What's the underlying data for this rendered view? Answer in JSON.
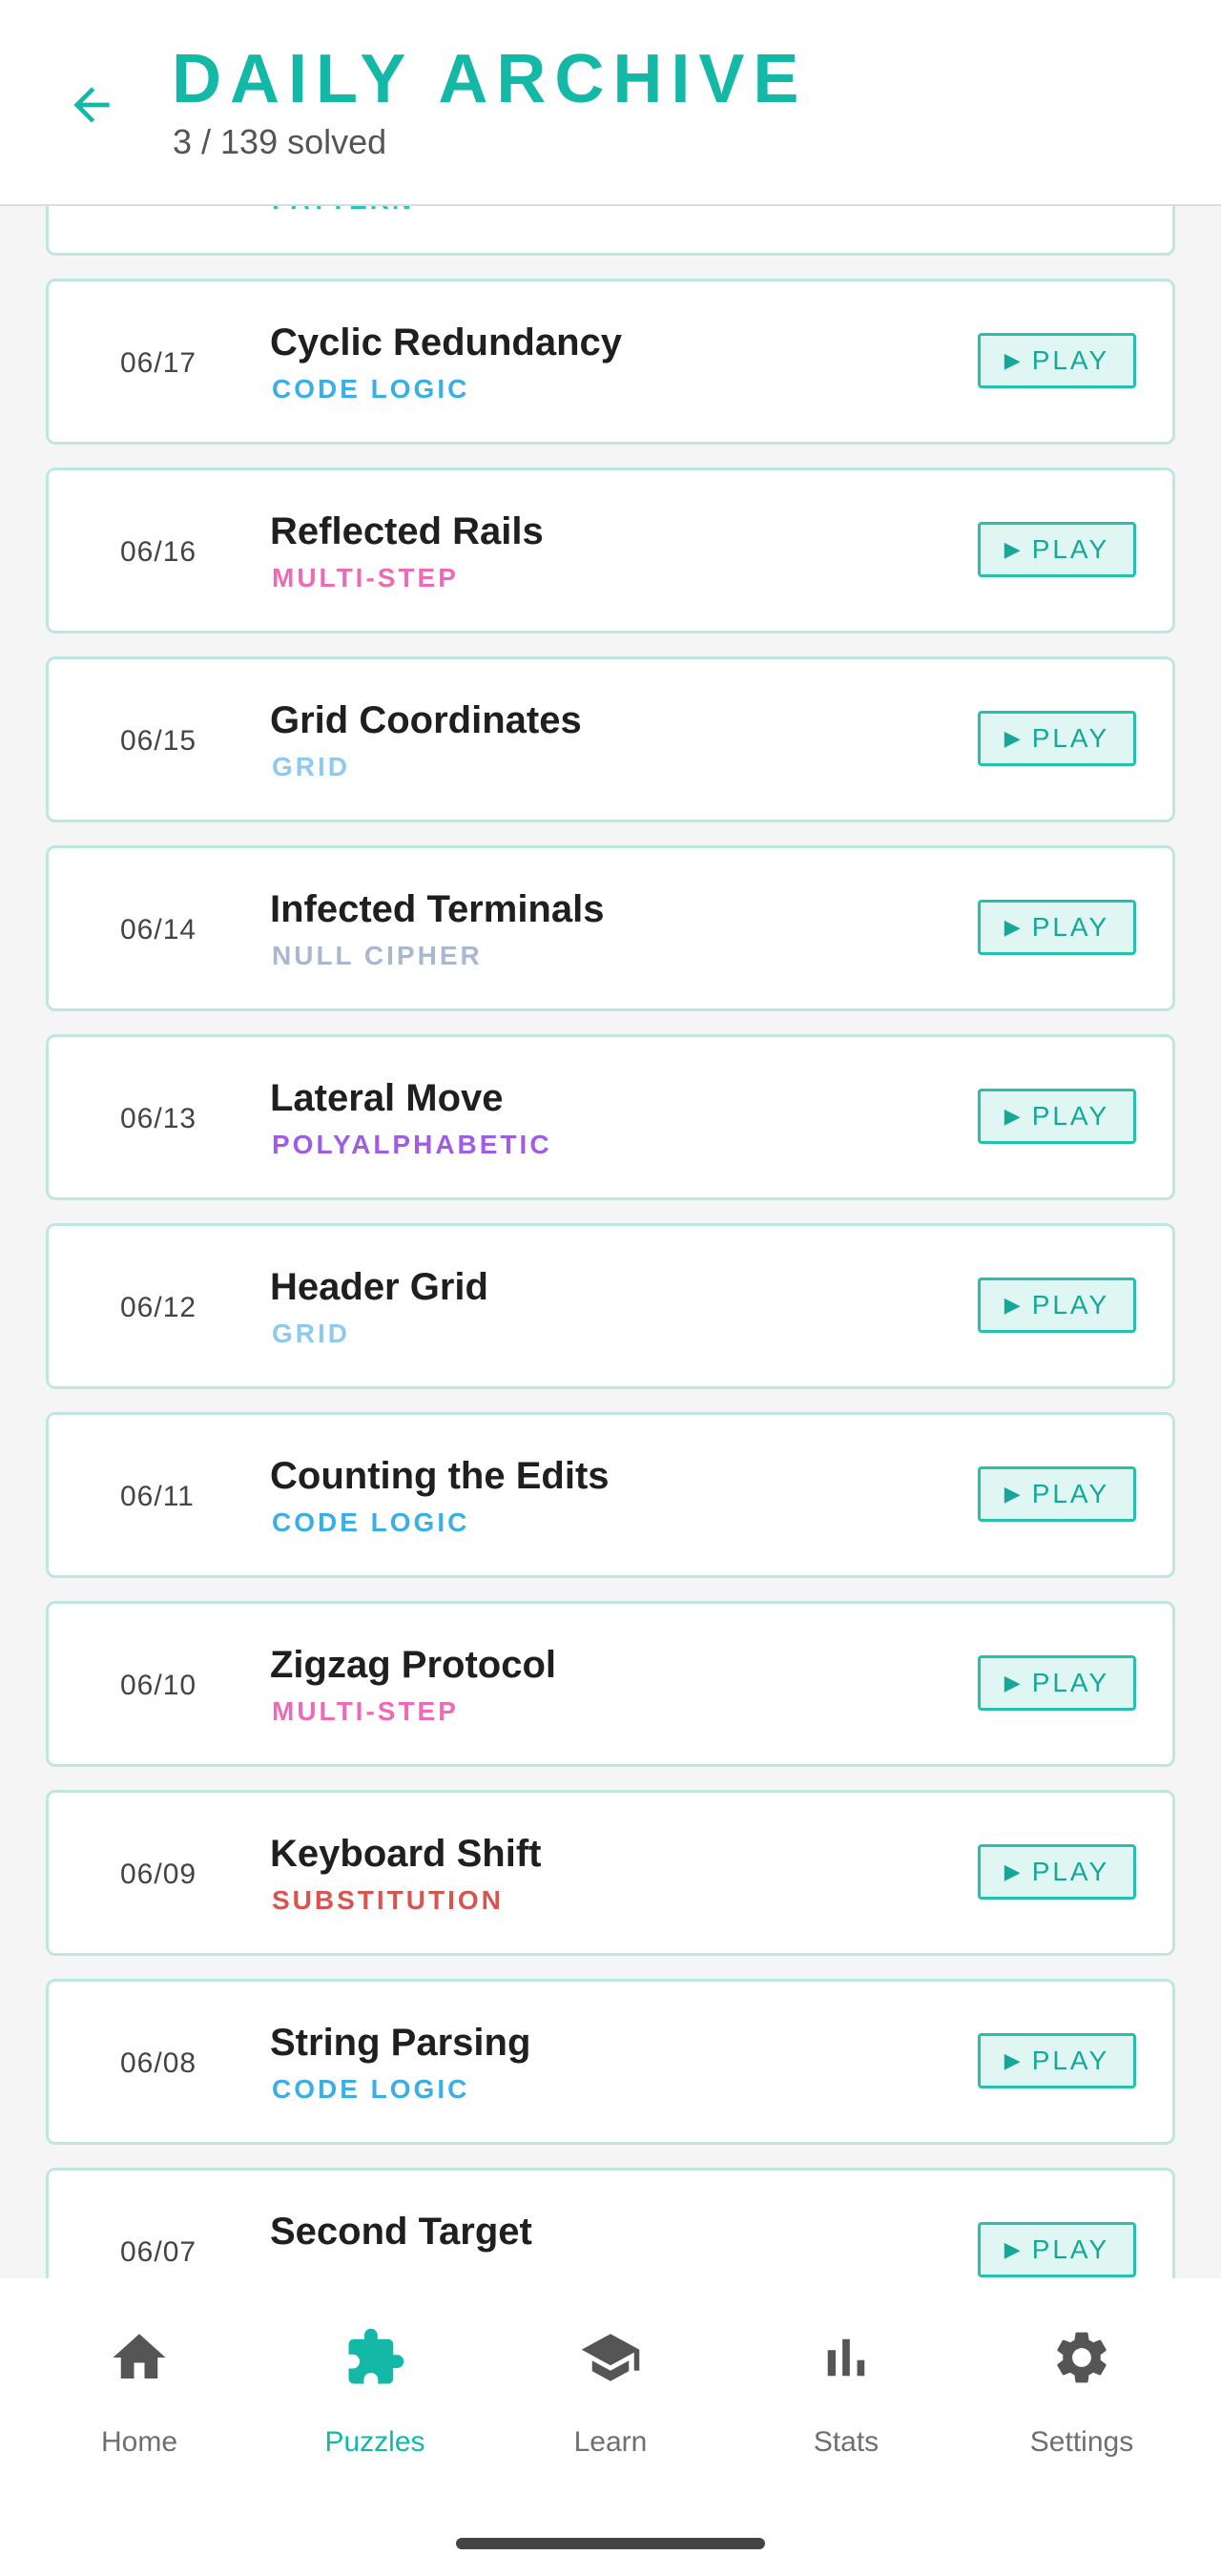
{
  "header": {
    "title": "DAILY ARCHIVE",
    "subtitle": "3 / 139 solved",
    "back_icon": "arrow-left-icon",
    "accent_color": "#13b8a6"
  },
  "play_label": "PLAY",
  "play_icon": "play-triangle-icon",
  "puzzles": [
    {
      "date": "",
      "title": "",
      "category": "PATTERN",
      "category_color": "#2bc4b4"
    },
    {
      "date": "06/17",
      "title": "Cyclic Redundancy",
      "category": "CODE LOGIC",
      "category_color": "#3aaee6"
    },
    {
      "date": "06/16",
      "title": "Reflected Rails",
      "category": "MULTI-STEP",
      "category_color": "#ec6bb4"
    },
    {
      "date": "06/15",
      "title": "Grid Coordinates",
      "category": "GRID",
      "category_color": "#8ec9ee"
    },
    {
      "date": "06/14",
      "title": "Infected Terminals",
      "category": "NULL CIPHER",
      "category_color": "#a9b8ce"
    },
    {
      "date": "06/13",
      "title": "Lateral Move",
      "category": "POLYALPHABETIC",
      "category_color": "#a05ce6"
    },
    {
      "date": "06/12",
      "title": "Header Grid",
      "category": "GRID",
      "category_color": "#8ec9ee"
    },
    {
      "date": "06/11",
      "title": "Counting the Edits",
      "category": "CODE LOGIC",
      "category_color": "#3aaee6"
    },
    {
      "date": "06/10",
      "title": "Zigzag Protocol",
      "category": "MULTI-STEP",
      "category_color": "#ec6bb4"
    },
    {
      "date": "06/09",
      "title": "Keyboard Shift",
      "category": "SUBSTITUTION",
      "category_color": "#d9534f"
    },
    {
      "date": "06/08",
      "title": "String Parsing",
      "category": "CODE LOGIC",
      "category_color": "#3aaee6"
    },
    {
      "date": "06/07",
      "title": "Second Target",
      "category": "",
      "category_color": "#3aaee6"
    }
  ],
  "nav": [
    {
      "label": "Home",
      "icon": "home-icon",
      "active": false
    },
    {
      "label": "Puzzles",
      "icon": "puzzle-icon",
      "active": true
    },
    {
      "label": "Learn",
      "icon": "graduation-cap-icon",
      "active": false
    },
    {
      "label": "Stats",
      "icon": "bar-chart-icon",
      "active": false
    },
    {
      "label": "Settings",
      "icon": "gear-icon",
      "active": false
    }
  ]
}
